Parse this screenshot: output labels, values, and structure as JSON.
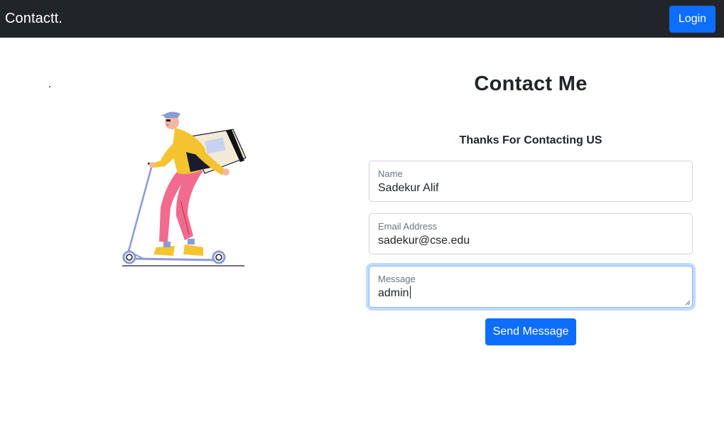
{
  "colors": {
    "accent": "#0d6efd",
    "navbar_bg": "#212529"
  },
  "navbar": {
    "brand": "Contactt.",
    "login_label": "Login"
  },
  "illustration": {
    "description_icon": "delivery-person-on-scooter-illustration"
  },
  "contact": {
    "title": "Contact Me",
    "thanks_message": "Thanks For Contacting US",
    "fields": {
      "name": {
        "label": "Name",
        "value": "Sadekur Alif"
      },
      "email": {
        "label": "Email Address",
        "value": "sadekur@cse.edu"
      },
      "message": {
        "label": "Message",
        "value": "admin"
      }
    },
    "send_label": "Send Message"
  }
}
